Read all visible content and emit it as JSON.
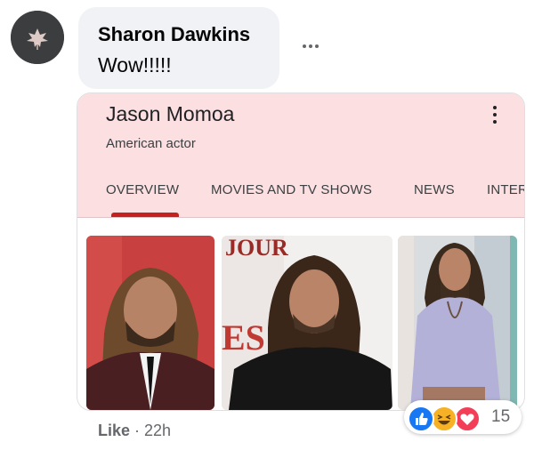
{
  "comment": {
    "author": "Sharon Dawkins",
    "text": "Wow!!!!!",
    "more_icon": "more-horizontal-icon"
  },
  "knowledge_card": {
    "title": "Jason Momoa",
    "subtitle": "American actor",
    "menu_icon": "more-vertical-icon",
    "tabs": [
      {
        "label": "OVERVIEW",
        "active": true
      },
      {
        "label": "MOVIES AND TV SHOWS",
        "active": false
      },
      {
        "label": "NEWS",
        "active": false
      },
      {
        "label": "INTER",
        "active": false
      }
    ],
    "accent_color": "#c5221f",
    "header_color": "#fbdfe1"
  },
  "footer": {
    "like_label": "Like",
    "separator": " · ",
    "time": "22h",
    "reaction_count": "15",
    "reaction_icons": [
      "like-icon",
      "haha-icon",
      "love-icon"
    ]
  }
}
